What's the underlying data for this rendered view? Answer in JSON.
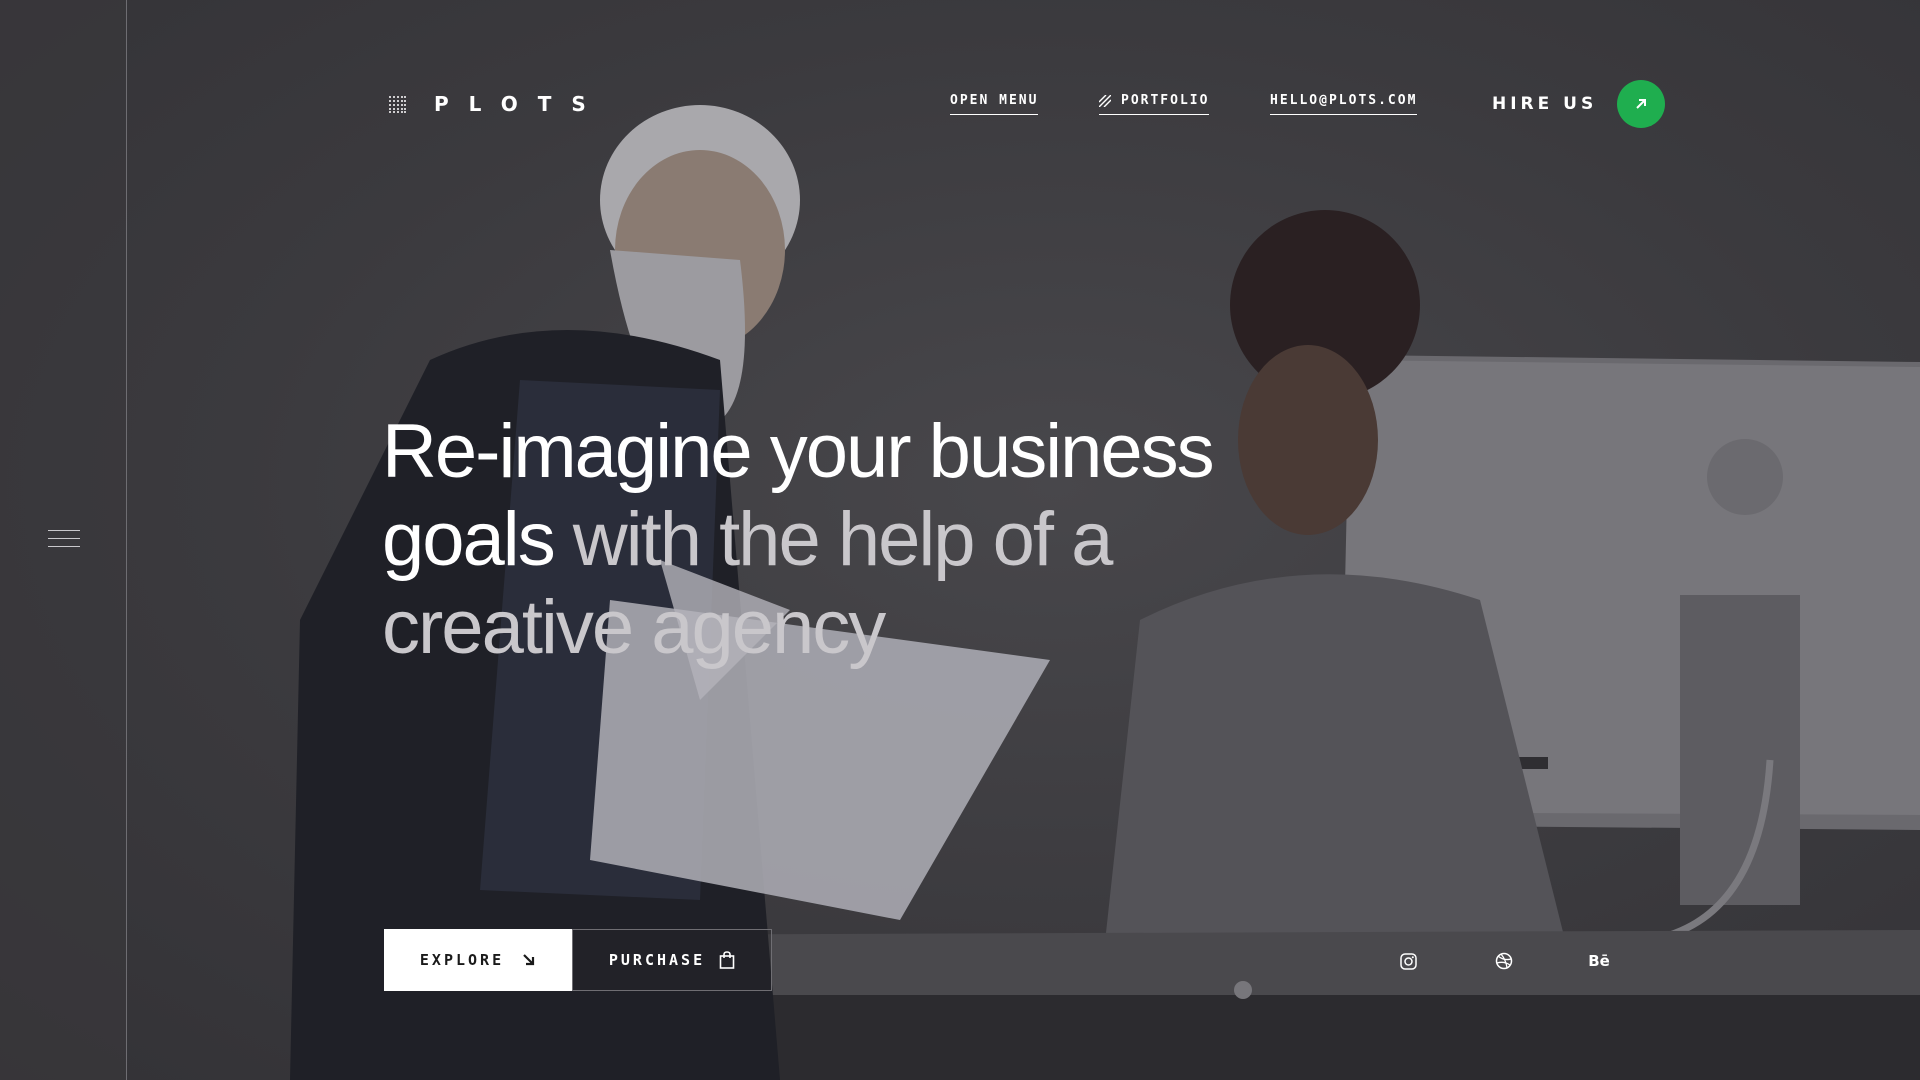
{
  "brand": {
    "name": "PLOTS",
    "logo_icon": "dot-grid-icon"
  },
  "nav": {
    "open_menu": "OPEN MENU",
    "portfolio": "PORTFOLIO",
    "portfolio_icon": "slash-lines-icon",
    "email": "HELLO@PLOTS.COM"
  },
  "hire": {
    "label": "HIRE US",
    "icon": "arrow-up-right-icon",
    "color": "#1fae4f"
  },
  "hero": {
    "line1": "Re-imagine your business",
    "line2_white": "goals",
    "line2_grey": " with the help of a",
    "line3": "creative agency"
  },
  "actions": {
    "explore": "EXPLORE",
    "explore_icon": "arrow-down-right-icon",
    "purchase": "PURCHASE",
    "purchase_icon": "shopping-bag-icon"
  },
  "social": {
    "instagram_icon": "instagram-icon",
    "dribbble_icon": "dribbble-icon",
    "behance_label": "Bē"
  },
  "sidebar": {
    "menu_icon": "hamburger-icon"
  }
}
